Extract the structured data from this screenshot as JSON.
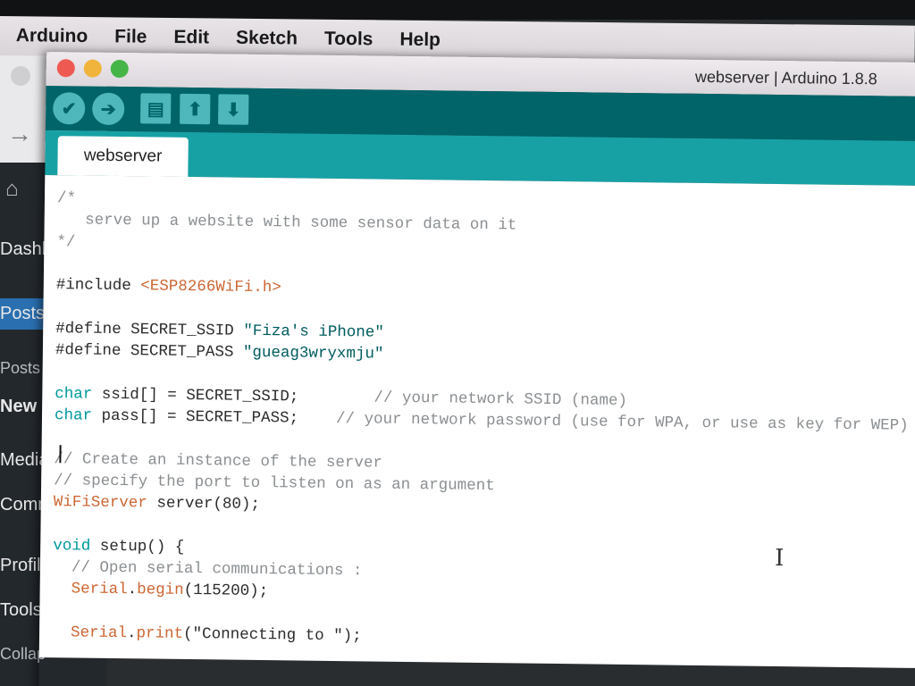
{
  "menubar": {
    "items": [
      "Arduino",
      "File",
      "Edit",
      "Sketch",
      "Tools",
      "Help"
    ]
  },
  "background_sidebar": {
    "items": [
      "Dashb",
      "Posts",
      "Posts",
      "New",
      "Media",
      "Comm",
      "Profile",
      "Tools",
      "Collap"
    ]
  },
  "window": {
    "title": "webserver | Arduino 1.8.8",
    "tab": "webserver"
  },
  "toolbar": {
    "verify_icon": "✔",
    "upload_icon": "➔",
    "new_icon": "▤",
    "open_icon": "⬆",
    "save_icon": "⬇"
  },
  "code": {
    "lines": [
      [
        {
          "t": "/*",
          "c": "comment"
        }
      ],
      [
        {
          "t": "   serve up a website with some sensor data on it",
          "c": "comment"
        }
      ],
      [
        {
          "t": "*/",
          "c": "comment"
        }
      ],
      [
        {
          "t": "",
          "c": "text"
        }
      ],
      [
        {
          "t": "#include ",
          "c": "text"
        },
        {
          "t": "<ESP8266WiFi.h>",
          "c": "keyword"
        }
      ],
      [
        {
          "t": "",
          "c": "text"
        }
      ],
      [
        {
          "t": "#define SECRET_SSID ",
          "c": "text"
        },
        {
          "t": "\"Fiza's iPhone\"",
          "c": "string"
        }
      ],
      [
        {
          "t": "#define SECRET_PASS ",
          "c": "text"
        },
        {
          "t": "\"gueag3wryxmju\"",
          "c": "string"
        }
      ],
      [
        {
          "t": "",
          "c": "text"
        }
      ],
      [
        {
          "t": "char",
          "c": "type"
        },
        {
          "t": " ssid[] = SECRET_SSID;        ",
          "c": "text"
        },
        {
          "t": "// your network SSID (name)",
          "c": "comment"
        }
      ],
      [
        {
          "t": "char",
          "c": "type"
        },
        {
          "t": " pass[] = SECRET_PASS;    ",
          "c": "text"
        },
        {
          "t": "// your network password (use for WPA, or use as key for WEP)",
          "c": "comment"
        }
      ],
      [
        {
          "t": "",
          "c": "text"
        }
      ],
      [
        {
          "t": "// Create an instance of the server",
          "c": "comment"
        }
      ],
      [
        {
          "t": "// specify the port to listen on as an argument",
          "c": "comment"
        }
      ],
      [
        {
          "t": "WiFiServer",
          "c": "keyword"
        },
        {
          "t": " server(80);",
          "c": "text"
        }
      ],
      [
        {
          "t": "",
          "c": "text"
        }
      ],
      [
        {
          "t": "void",
          "c": "type"
        },
        {
          "t": " setup() {",
          "c": "text"
        }
      ],
      [
        {
          "t": "  // Open serial communications :",
          "c": "comment"
        }
      ],
      [
        {
          "t": "  ",
          "c": "text"
        },
        {
          "t": "Serial",
          "c": "keyword"
        },
        {
          "t": ".",
          "c": "text"
        },
        {
          "t": "begin",
          "c": "keyword"
        },
        {
          "t": "(115200);",
          "c": "text"
        }
      ],
      [
        {
          "t": "",
          "c": "text"
        }
      ],
      [
        {
          "t": "  ",
          "c": "text"
        },
        {
          "t": "Serial",
          "c": "keyword"
        },
        {
          "t": ".",
          "c": "text"
        },
        {
          "t": "print",
          "c": "keyword"
        },
        {
          "t": "(\"Connecting to \");",
          "c": "text"
        }
      ]
    ]
  },
  "colors": {
    "toolbar": "#006468",
    "tabstrip": "#17a1a5",
    "button": "#4db7bb",
    "comment": "#8b8f92",
    "keyword": "#cc6633",
    "type": "#00979c"
  }
}
